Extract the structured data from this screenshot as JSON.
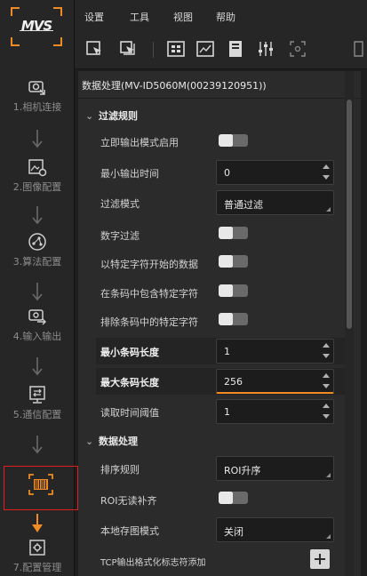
{
  "menu": [
    "设置",
    "工具",
    "视图",
    "帮助"
  ],
  "logo_text": "MVS",
  "steps": [
    {
      "label": "1.相机连接",
      "icon": "camera-connect-icon"
    },
    {
      "label": "2.图像配置",
      "icon": "image-config-icon"
    },
    {
      "label": "3.算法配置",
      "icon": "algorithm-config-icon"
    },
    {
      "label": "4.输入输出",
      "icon": "io-config-icon"
    },
    {
      "label": "5.通信配置",
      "icon": "communication-icon"
    },
    {
      "label": "",
      "icon": "barcode-process-icon"
    },
    {
      "label": "7.配置管理",
      "icon": "config-manage-icon"
    }
  ],
  "panel": {
    "title": "数据处理(MV-ID5060M(00239120951))",
    "sections": {
      "filter": "过滤规则",
      "process": "数据处理"
    },
    "rows": {
      "immediate_output": "立即输出模式启用",
      "min_output_time": "最小输出时间",
      "min_output_time_value": "0",
      "filter_mode": "过滤模式",
      "filter_mode_value": "普通过滤",
      "digit_filter": "数字过滤",
      "starts_with_char": "以特定字符开始的数据",
      "contains_char": "在条码中包含特定字符",
      "exclude_char": "排除条码中的特定字符",
      "min_len": "最小条码长度",
      "min_len_value": "1",
      "max_len": "最大条码长度",
      "max_len_value": "256",
      "read_threshold": "读取时间阈值",
      "read_threshold_value": "1",
      "sort_rule": "排序规则",
      "sort_rule_value": "ROI升序",
      "roi_fill": "ROI无读补齐",
      "local_save": "本地存图模式",
      "local_save_value": "关闭",
      "tcp_flag": "TCP输出格式化标志符添加"
    }
  },
  "colors": {
    "accent": "#f08a24",
    "highlight": "#e02020"
  }
}
